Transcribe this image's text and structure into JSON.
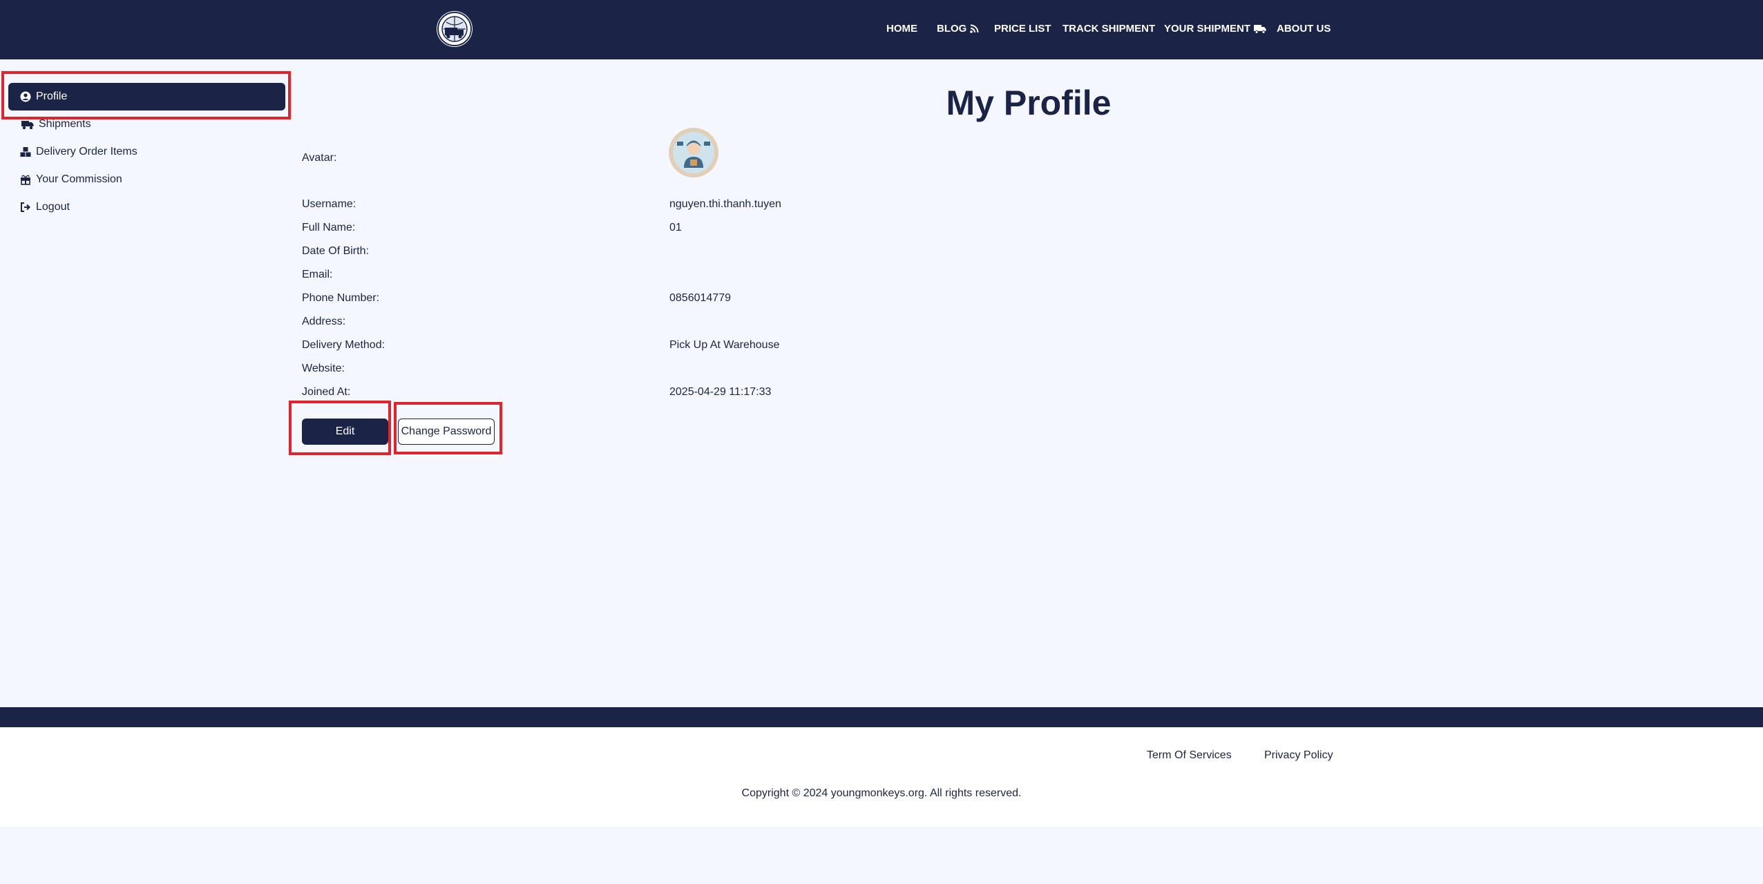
{
  "header": {
    "logo_icon": "truck-globe-logo",
    "nav": [
      {
        "label": "HOME"
      },
      {
        "label": "BLOG",
        "icon": "rss-icon"
      },
      {
        "label": "PRICE LIST"
      },
      {
        "label": "TRACK SHIPMENT"
      },
      {
        "label": "YOUR SHIPMENT",
        "icon": "truck-icon"
      },
      {
        "label": "ABOUT US"
      }
    ]
  },
  "sidebar": {
    "items": [
      {
        "label": "Profile",
        "icon": "user-circle-icon",
        "active": true
      },
      {
        "label": "Shipments",
        "icon": "truck-fast-icon"
      },
      {
        "label": "Delivery Order Items",
        "icon": "boxes-icon"
      },
      {
        "label": "Your Commission",
        "icon": "gift-box-icon"
      },
      {
        "label": "Logout",
        "icon": "logout-icon"
      }
    ]
  },
  "profile": {
    "title": "My Profile",
    "avatar_label": "Avatar:",
    "fields": [
      {
        "label": "Username:",
        "value": "nguyen.thi.thanh.tuyen"
      },
      {
        "label": "Full Name:",
        "value": "01"
      },
      {
        "label": "Date Of Birth:",
        "value": ""
      },
      {
        "label": "Email:",
        "value": ""
      },
      {
        "label": "Phone Number:",
        "value": "0856014779"
      },
      {
        "label": "Address:",
        "value": ""
      },
      {
        "label": "Delivery Method:",
        "value": "Pick Up At Warehouse"
      },
      {
        "label": "Website:",
        "value": ""
      },
      {
        "label": "Joined At:",
        "value": "2025-04-29 11:17:33"
      }
    ],
    "edit_label": "Edit",
    "change_password_label": "Change Password"
  },
  "footer": {
    "links": [
      {
        "label": "Term Of Services"
      },
      {
        "label": "Privacy Policy"
      }
    ],
    "copyright": "Copyright © 2024 youngmonkeys.org. All rights reserved."
  },
  "colors": {
    "navy": "#1b2447",
    "page_bg": "#f5f7ff",
    "highlight": "#e3222b"
  }
}
